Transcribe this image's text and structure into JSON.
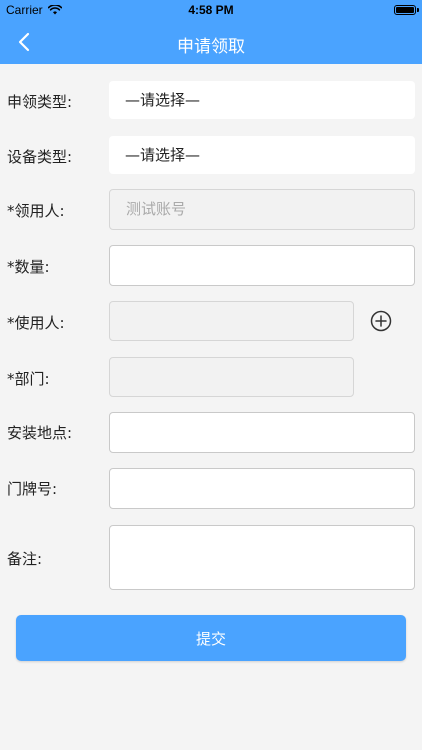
{
  "status_bar": {
    "carrier": "Carrier",
    "time": "4:58 PM",
    "wifi_icon": "wifi-icon",
    "battery_icon": "battery-icon"
  },
  "nav": {
    "title": "申请领取",
    "back_icon": "chevron-left-icon"
  },
  "form": {
    "apply_type": {
      "label": "申领类型:",
      "value": "—请选择—"
    },
    "device_type": {
      "label": "设备类型:",
      "value": "—请选择—"
    },
    "recipient": {
      "label": "*领用人:",
      "value": "测试账号"
    },
    "quantity": {
      "label": "*数量:",
      "value": ""
    },
    "user": {
      "label": "*使用人:",
      "value": "",
      "add_icon": "plus-circle-icon"
    },
    "department": {
      "label": "*部门:",
      "value": ""
    },
    "install_location": {
      "label": "安装地点:",
      "value": ""
    },
    "door_number": {
      "label": "门牌号:",
      "value": ""
    },
    "remarks": {
      "label": "备注:",
      "value": ""
    }
  },
  "submit_label": "提交",
  "colors": {
    "accent": "#4aa3ff",
    "background": "#f4f4f4",
    "disabled_field": "#f2f2f2"
  }
}
